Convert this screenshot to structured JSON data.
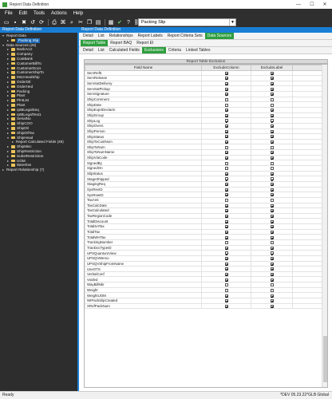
{
  "window": {
    "title": "Report Data Definition",
    "minimize": "—",
    "maximize": "☐",
    "close": "✕"
  },
  "menu": [
    "File",
    "Edit",
    "Tools",
    "Actions",
    "Help"
  ],
  "toolbar": {
    "combo_value": "Packing Slip"
  },
  "left_pane": {
    "header": "Report Data Definition",
    "tree": [
      {
        "label": "Report Data",
        "level": 0,
        "expander": "▾",
        "folder": false
      },
      {
        "label": "Packing Slip",
        "level": 1,
        "expander": "▸",
        "folder": true,
        "selected": true
      },
      {
        "label": "Data Sources (26)",
        "level": 0,
        "expander": "▾",
        "folder": false
      },
      {
        "label": "BankAcct",
        "level": 1,
        "expander": "▸",
        "folder": true
      },
      {
        "label": "Company",
        "level": 1,
        "expander": "▸",
        "folder": true
      },
      {
        "label": "CustBank",
        "level": 1,
        "expander": "▸",
        "folder": true
      },
      {
        "label": "CustomerBillTo",
        "level": 1,
        "expander": "▸",
        "folder": true
      },
      {
        "label": "CustomerDocs",
        "level": 1,
        "expander": "▸",
        "folder": true
      },
      {
        "label": "CustomerShipTo",
        "level": 1,
        "expander": "▸",
        "folder": true
      },
      {
        "label": "MscHeadShip",
        "level": 1,
        "expander": "▸",
        "folder": true
      },
      {
        "label": "OrderDtl",
        "level": 1,
        "expander": "▸",
        "folder": true
      },
      {
        "label": "OrderHed",
        "level": 1,
        "expander": "▸",
        "folder": true
      },
      {
        "label": "Packing",
        "level": 1,
        "expander": "▸",
        "folder": true
      },
      {
        "label": "Plant",
        "level": 1,
        "expander": "▸",
        "folder": true
      },
      {
        "label": "PlntList",
        "level": 1,
        "expander": "▸",
        "folder": true
      },
      {
        "label": "Plant",
        "level": 1,
        "expander": "▸",
        "folder": true
      },
      {
        "label": "rptBLegalSeq",
        "level": 1,
        "expander": "▸",
        "folder": true
      },
      {
        "label": "rptBLegalText1",
        "level": 1,
        "expander": "▸",
        "folder": true
      },
      {
        "label": "SerialNo",
        "level": 1,
        "expander": "▸",
        "folder": true
      },
      {
        "label": "ShipCOO",
        "level": 1,
        "expander": "▸",
        "folder": true
      },
      {
        "label": "ShipDtl",
        "level": 1,
        "expander": "▸",
        "folder": true
      },
      {
        "label": "ShipDtlTax",
        "level": 1,
        "expander": "▸",
        "folder": true
      },
      {
        "label": "ShipHead",
        "level": 1,
        "expander": "▾",
        "folder": true
      },
      {
        "label": "Report Calculated Fields (49)",
        "level": 2,
        "expander": "▸",
        "folder": false
      },
      {
        "label": "ShipMisc",
        "level": 1,
        "expander": "▸",
        "folder": true
      },
      {
        "label": "ShipRestriction",
        "level": 1,
        "expander": "▸",
        "folder": true
      },
      {
        "label": "SubstRestriction",
        "level": 1,
        "expander": "▸",
        "folder": true
      },
      {
        "label": "UOM",
        "level": 1,
        "expander": "▸",
        "folder": true
      },
      {
        "label": "Warehse",
        "level": 1,
        "expander": "▸",
        "folder": true
      },
      {
        "label": "Report Relationship (7)",
        "level": 0,
        "expander": "▸",
        "folder": false
      }
    ]
  },
  "right_pane": {
    "header": "Report Data Definition",
    "tabs_row1": [
      "Detail",
      "List",
      "Relationships",
      "Report Labels",
      "Report Criteria Sets",
      "Data Sources"
    ],
    "tabs_row1_active": 5,
    "tabs_row2": [
      "Report Table",
      "Report BAQ",
      "Report EI"
    ],
    "tabs_row2_active": 0,
    "tabs_row3": [
      "Detail",
      "List",
      "Calculated Fields",
      "Exclusions",
      "Criteria",
      "Linked Tables"
    ],
    "tabs_row3_active": 3,
    "grid_title": "Report Table Exclusion",
    "columns": [
      "Field Name",
      "ExcludeColumn",
      "ExcludeLabel"
    ],
    "rows": [
      [
        "ServRef5",
        true,
        true
      ],
      [
        "ServRelease",
        true,
        true
      ],
      [
        "ServSatDelivery",
        true,
        true
      ],
      [
        "ServSatPickup",
        true,
        true
      ],
      [
        "ServSignature",
        true,
        true
      ],
      [
        "ShipComment",
        false,
        false
      ],
      [
        "ShipDate",
        false,
        false
      ],
      [
        "ShipExprtDeclartn",
        true,
        true
      ],
      [
        "ShipGroup",
        true,
        true
      ],
      [
        "ShipLog",
        true,
        true
      ],
      [
        "ShipOvers",
        true,
        true
      ],
      [
        "ShipPerson",
        true,
        true
      ],
      [
        "ShipStatus",
        true,
        true
      ],
      [
        "ShipToCustNum",
        true,
        true
      ],
      [
        "ShipToNum",
        false,
        false
      ],
      [
        "ShipToNumName",
        true,
        true
      ],
      [
        "ShipViaCode",
        true,
        true
      ],
      [
        "SignedBy",
        false,
        false
      ],
      [
        "SignedOn",
        false,
        false
      ],
      [
        "SlipStatus",
        true,
        true
      ],
      [
        "StageShipped",
        true,
        true
      ],
      [
        "StagingReq",
        true,
        true
      ],
      [
        "SysRevID",
        true,
        true
      ],
      [
        "SysRowID",
        true,
        true
      ],
      [
        "TaxAmt",
        false,
        false
      ],
      [
        "TaxCalcDate",
        true,
        true
      ],
      [
        "TaxCalculated",
        true,
        true
      ],
      [
        "TaxRegionCode",
        true,
        true
      ],
      [
        "TotalDiscount",
        true,
        true
      ],
      [
        "TotalSATax",
        true,
        true
      ],
      [
        "TotalTax",
        true,
        true
      ],
      [
        "TotalWHTax",
        true,
        true
      ],
      [
        "TrackingNumber",
        false,
        false
      ],
      [
        "TranDocTypeID",
        true,
        true
      ],
      [
        "UPSQuantumView",
        true,
        true
      ],
      [
        "UPSQVMemo",
        true,
        true
      ],
      [
        "UPSQVShipFromName",
        true,
        true
      ],
      [
        "UseOTS",
        true,
        true
      ],
      [
        "VerbalConf",
        true,
        true
      ],
      [
        "Voided",
        true,
        true
      ],
      [
        "WayBillNbr",
        false,
        false
      ],
      [
        "Weight",
        false,
        false
      ],
      [
        "WeightUOM",
        true,
        true
      ],
      [
        "WIPackSlipCreated",
        true,
        true
      ],
      [
        "XRefPackNum",
        true,
        true
      ]
    ]
  },
  "status": {
    "left": "Ready",
    "right": "*DEV 05.23.22*GLB Global"
  }
}
